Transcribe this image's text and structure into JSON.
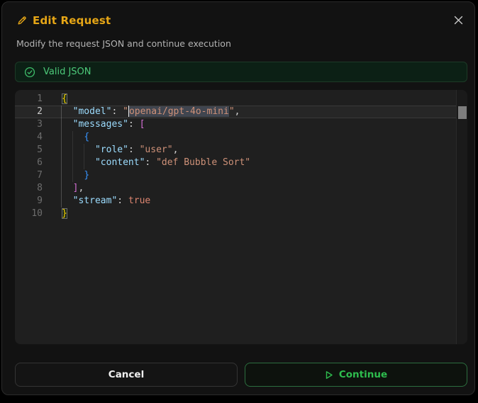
{
  "dialog": {
    "title": "Edit Request",
    "subtitle": "Modify the request JSON and continue execution"
  },
  "validation": {
    "status": "Valid JSON"
  },
  "editor": {
    "active_line": 2,
    "selection_text": "openai/gpt-4o-mini",
    "lines": [
      {
        "number": "1",
        "tokens": [
          {
            "t": "{",
            "c": "b1",
            "match": true
          }
        ]
      },
      {
        "number": "2",
        "tokens": [
          {
            "t": "  ",
            "c": "punc"
          },
          {
            "t": "\"model\"",
            "c": "key"
          },
          {
            "t": ": ",
            "c": "punc"
          },
          {
            "t": "\"",
            "c": "str"
          },
          {
            "t": "openai/gpt-4o-mini",
            "c": "str",
            "sel": true,
            "cursor": true
          },
          {
            "t": "\"",
            "c": "str"
          },
          {
            "t": ",",
            "c": "punc"
          }
        ]
      },
      {
        "number": "3",
        "tokens": [
          {
            "t": "  ",
            "c": "punc"
          },
          {
            "t": "\"messages\"",
            "c": "key"
          },
          {
            "t": ": ",
            "c": "punc"
          },
          {
            "t": "[",
            "c": "b2"
          }
        ]
      },
      {
        "number": "4",
        "tokens": [
          {
            "t": "    ",
            "c": "punc"
          },
          {
            "t": "{",
            "c": "b3"
          }
        ]
      },
      {
        "number": "5",
        "tokens": [
          {
            "t": "      ",
            "c": "punc"
          },
          {
            "t": "\"role\"",
            "c": "key"
          },
          {
            "t": ": ",
            "c": "punc"
          },
          {
            "t": "\"user\"",
            "c": "str"
          },
          {
            "t": ",",
            "c": "punc"
          }
        ]
      },
      {
        "number": "6",
        "tokens": [
          {
            "t": "      ",
            "c": "punc"
          },
          {
            "t": "\"content\"",
            "c": "key"
          },
          {
            "t": ": ",
            "c": "punc"
          },
          {
            "t": "\"def Bubble Sort\"",
            "c": "str"
          }
        ]
      },
      {
        "number": "7",
        "tokens": [
          {
            "t": "    ",
            "c": "punc"
          },
          {
            "t": "}",
            "c": "b3"
          }
        ]
      },
      {
        "number": "8",
        "tokens": [
          {
            "t": "  ",
            "c": "punc"
          },
          {
            "t": "]",
            "c": "b2"
          },
          {
            "t": ",",
            "c": "punc"
          }
        ]
      },
      {
        "number": "9",
        "tokens": [
          {
            "t": "  ",
            "c": "punc"
          },
          {
            "t": "\"stream\"",
            "c": "key"
          },
          {
            "t": ": ",
            "c": "punc"
          },
          {
            "t": "true",
            "c": "bool"
          }
        ]
      },
      {
        "number": "10",
        "tokens": [
          {
            "t": "}",
            "c": "b1",
            "match": true
          }
        ]
      }
    ]
  },
  "footer": {
    "cancel": "Cancel",
    "continue": "Continue"
  },
  "colors": {
    "accent_gold": "#e6a616",
    "success_green": "#2ebd4e",
    "badge_text": "#4cc979",
    "json_key": "#9cdcfe",
    "json_string": "#ce9178",
    "json_bool": "#dd8570",
    "bracket_level1": "#ffd700",
    "bracket_level2": "#d670d6",
    "bracket_level3": "#3794ff",
    "editor_bg": "#1f1f1f",
    "selection_bg": "#40454f",
    "modal_bg": "#121212"
  }
}
